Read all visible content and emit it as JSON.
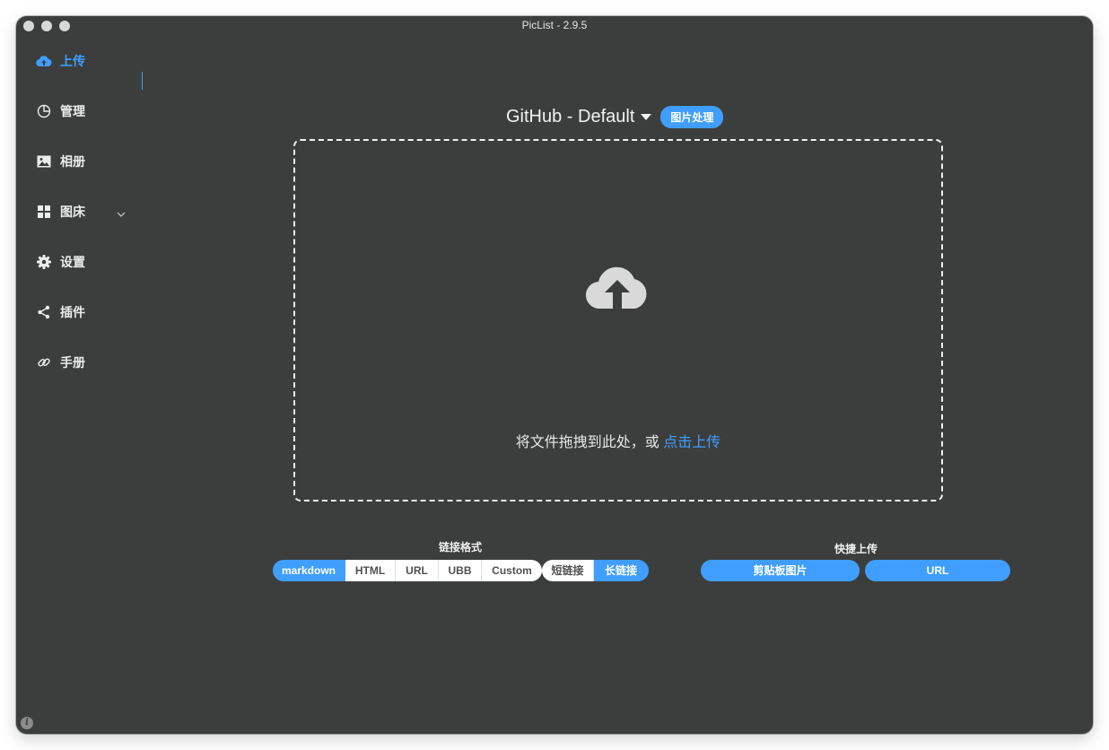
{
  "window": {
    "title": "PicList - 2.9.5"
  },
  "sidebar": {
    "items": [
      {
        "label": "上传",
        "icon": "cloud-upload-icon",
        "active": true
      },
      {
        "label": "管理",
        "icon": "pie-chart-icon"
      },
      {
        "label": "相册",
        "icon": "image-icon"
      },
      {
        "label": "图床",
        "icon": "grid-icon",
        "expandable": true
      },
      {
        "label": "设置",
        "icon": "gear-icon"
      },
      {
        "label": "插件",
        "icon": "share-icon"
      },
      {
        "label": "手册",
        "icon": "link-icon"
      }
    ]
  },
  "upload": {
    "picbed_name": "GitHub - Default",
    "image_process_button": "图片处理",
    "drop_hint": "将文件拖拽到此处，或 ",
    "click_upload": "点击上传"
  },
  "link_format": {
    "label": "链接格式",
    "options": [
      "markdown",
      "HTML",
      "URL",
      "UBB",
      "Custom"
    ],
    "selected": "markdown",
    "length_options": [
      "短链接",
      "长链接"
    ],
    "length_selected": "长链接"
  },
  "quick_upload": {
    "label": "快捷上传",
    "clipboard_button": "剪贴板图片",
    "url_button": "URL"
  },
  "colors": {
    "accent": "#409eff",
    "background": "#3b3e3c"
  }
}
